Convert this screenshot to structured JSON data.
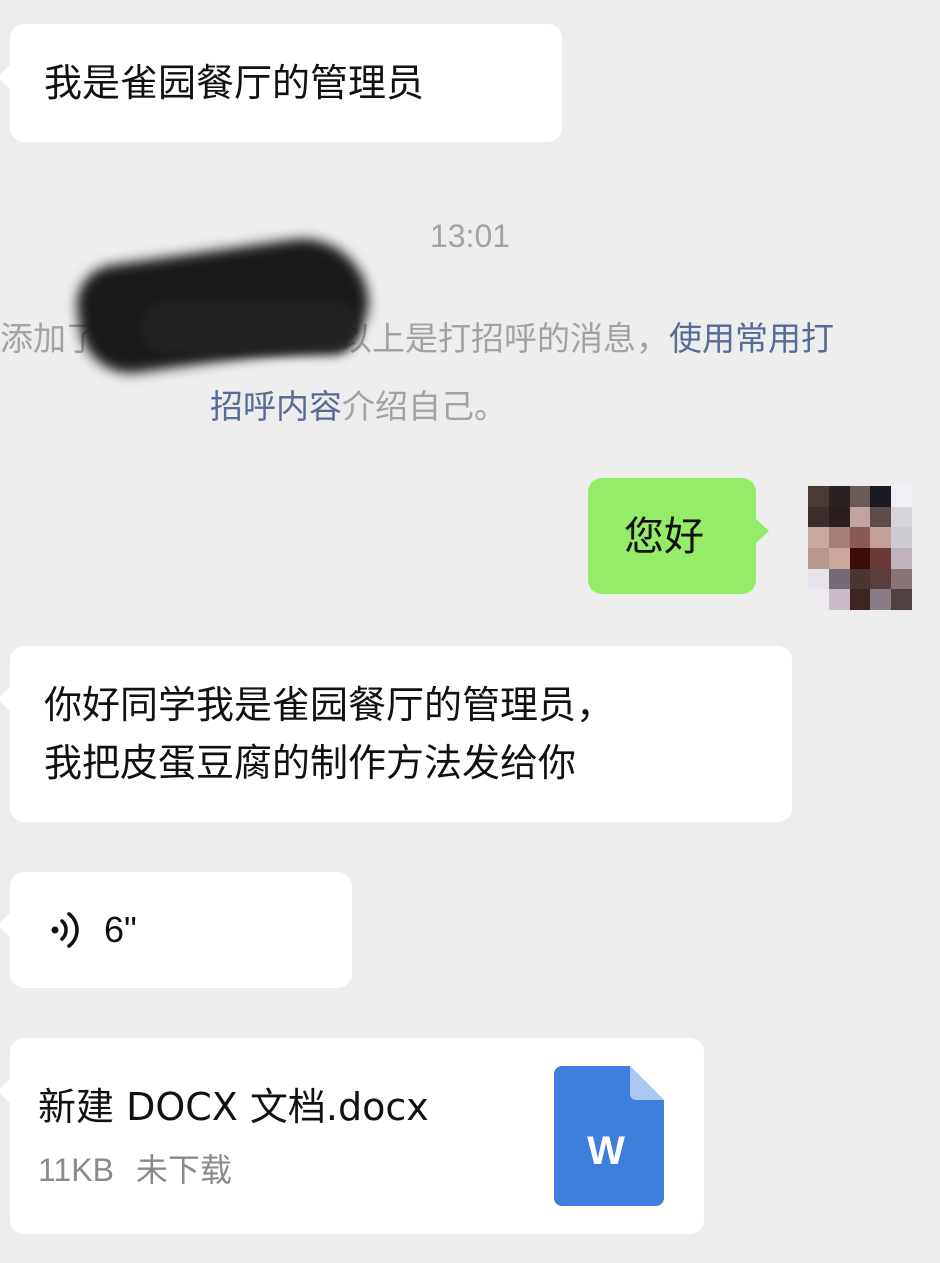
{
  "messages": {
    "m1": "我是雀园餐厅的管理员",
    "timestamp": "13:01",
    "system_prefix": "添加了",
    "system_mid": "以上是打招呼的消息，",
    "system_link1": "使用常用打",
    "system_link2": "招呼内容",
    "system_suffix": "介绍自己。",
    "m2": "您好",
    "m3_line1": "你好同学我是雀园餐厅的管理员，",
    "m3_line2": "我把皮蛋豆腐的制作方法发给你",
    "voice_duration": "6\"",
    "file_name": "新建 DOCX 文档.docx",
    "file_size": "11KB",
    "file_status": "未下载",
    "doc_icon_letter": "W"
  },
  "colors": {
    "background": "#ededed",
    "incoming_bubble": "#ffffff",
    "outgoing_bubble": "#95ec69",
    "link": "#576b95",
    "system_text": "#a3a3a3",
    "doc_icon": "#3d7fdb"
  },
  "icons": {
    "voice": "voice-wave-icon",
    "file": "word-document-icon"
  }
}
